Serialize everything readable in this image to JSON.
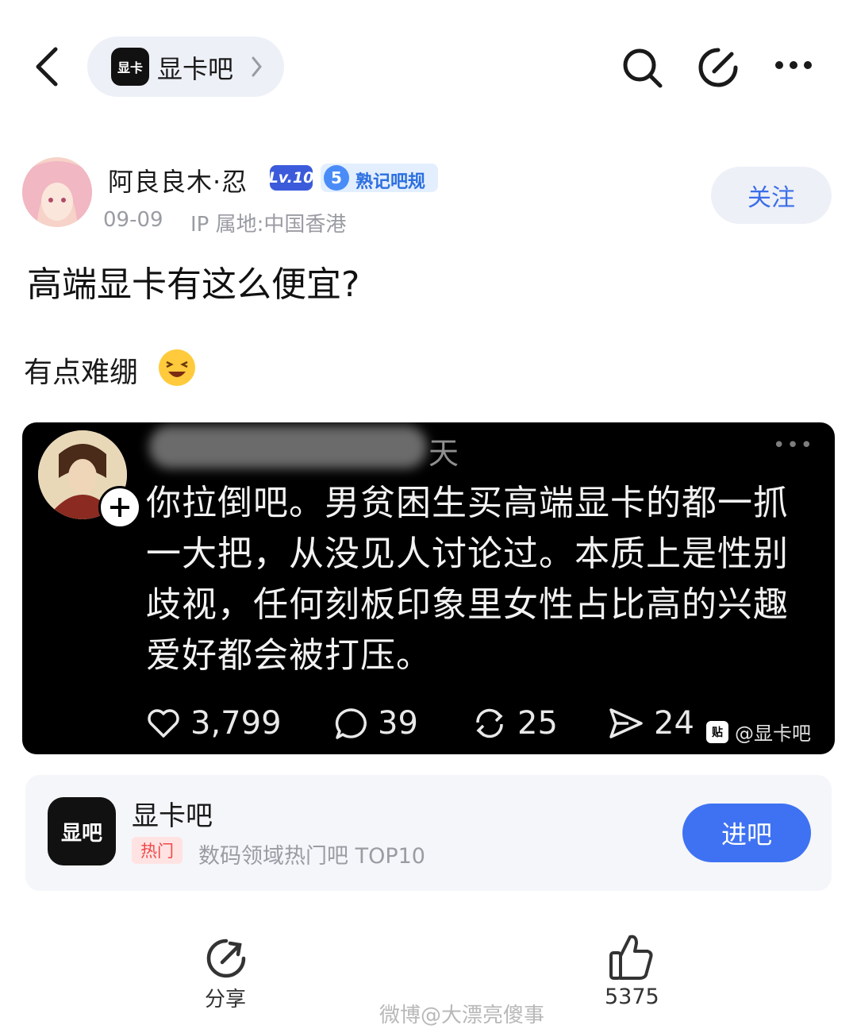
{
  "header": {
    "forum_name": "显卡吧",
    "forum_logo_text": "显卡"
  },
  "author": {
    "name": "阿良良木·忍",
    "level": "Lv.10",
    "rule_badge_num": "5",
    "rule_badge_text": "熟记吧规",
    "date": "09-09",
    "ip": "IP 属地:中国香港",
    "follow_label": "关注"
  },
  "post": {
    "title": "高端显卡有这么便宜?",
    "text": "有点难绷"
  },
  "embedded": {
    "name_suffix": "天",
    "more": "•••",
    "text": "你拉倒吧。男贫困生买高端显卡的都一抓一大把，从没见人讨论过。本质上是性别歧视，任何刻板印象里女性占比高的兴趣爱好都会被打压。",
    "likes": "3,799",
    "comments": "39",
    "reposts": "25",
    "shares": "24",
    "watermark": "@显卡吧",
    "watermark_icon": "贴"
  },
  "forum_card": {
    "logo_text": "显吧",
    "name": "显卡吧",
    "hot_tag": "热门",
    "desc": "数码领域热门吧 TOP10",
    "enter_label": "进吧"
  },
  "footer": {
    "share_label": "分享",
    "like_count": "5375",
    "watermark": "微博@大漂亮傻事"
  },
  "colors": {
    "accent": "#3e72f2",
    "level_badge": "#3b5bdb",
    "hot": "#f04848"
  }
}
